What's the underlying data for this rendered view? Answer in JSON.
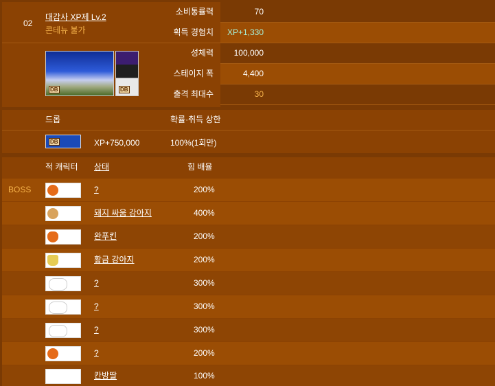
{
  "header": {
    "stage_no": "02",
    "stage_name": "대감사 XP제 Lv.2",
    "stage_note": "콘테뉴 불가"
  },
  "stats": [
    {
      "label": "소비통률력",
      "value": "70"
    },
    {
      "label": "획득 경험치",
      "value": "XP+1,330"
    },
    {
      "label": "성체력",
      "value": "100,000"
    },
    {
      "label": "스테이지 폭",
      "value": "4,400"
    },
    {
      "label": "출격 최대수",
      "value": "30"
    }
  ],
  "drop": {
    "title": "드롭",
    "rate_title": "확률·취득 상한",
    "reward": "XP+750,000",
    "rate": "100%(1회만)"
  },
  "enemies": {
    "col1": "적 캐릭터",
    "col2": "상태",
    "col3": "힘 배율",
    "rows": [
      {
        "tag": "BOSS",
        "name": "?",
        "ratio": "200%"
      },
      {
        "tag": "",
        "name": "돼지 싸움 강아지",
        "ratio": "400%"
      },
      {
        "tag": "",
        "name": "완푸킨",
        "ratio": "200%"
      },
      {
        "tag": "",
        "name": "황금 강아지",
        "ratio": "200%"
      },
      {
        "tag": "",
        "name": "?",
        "ratio": "300%"
      },
      {
        "tag": "",
        "name": "?",
        "ratio": "300%"
      },
      {
        "tag": "",
        "name": "?",
        "ratio": "300%"
      },
      {
        "tag": "",
        "name": "?",
        "ratio": "200%"
      },
      {
        "tag": "",
        "name": "칸방딸",
        "ratio": "100%"
      }
    ]
  }
}
